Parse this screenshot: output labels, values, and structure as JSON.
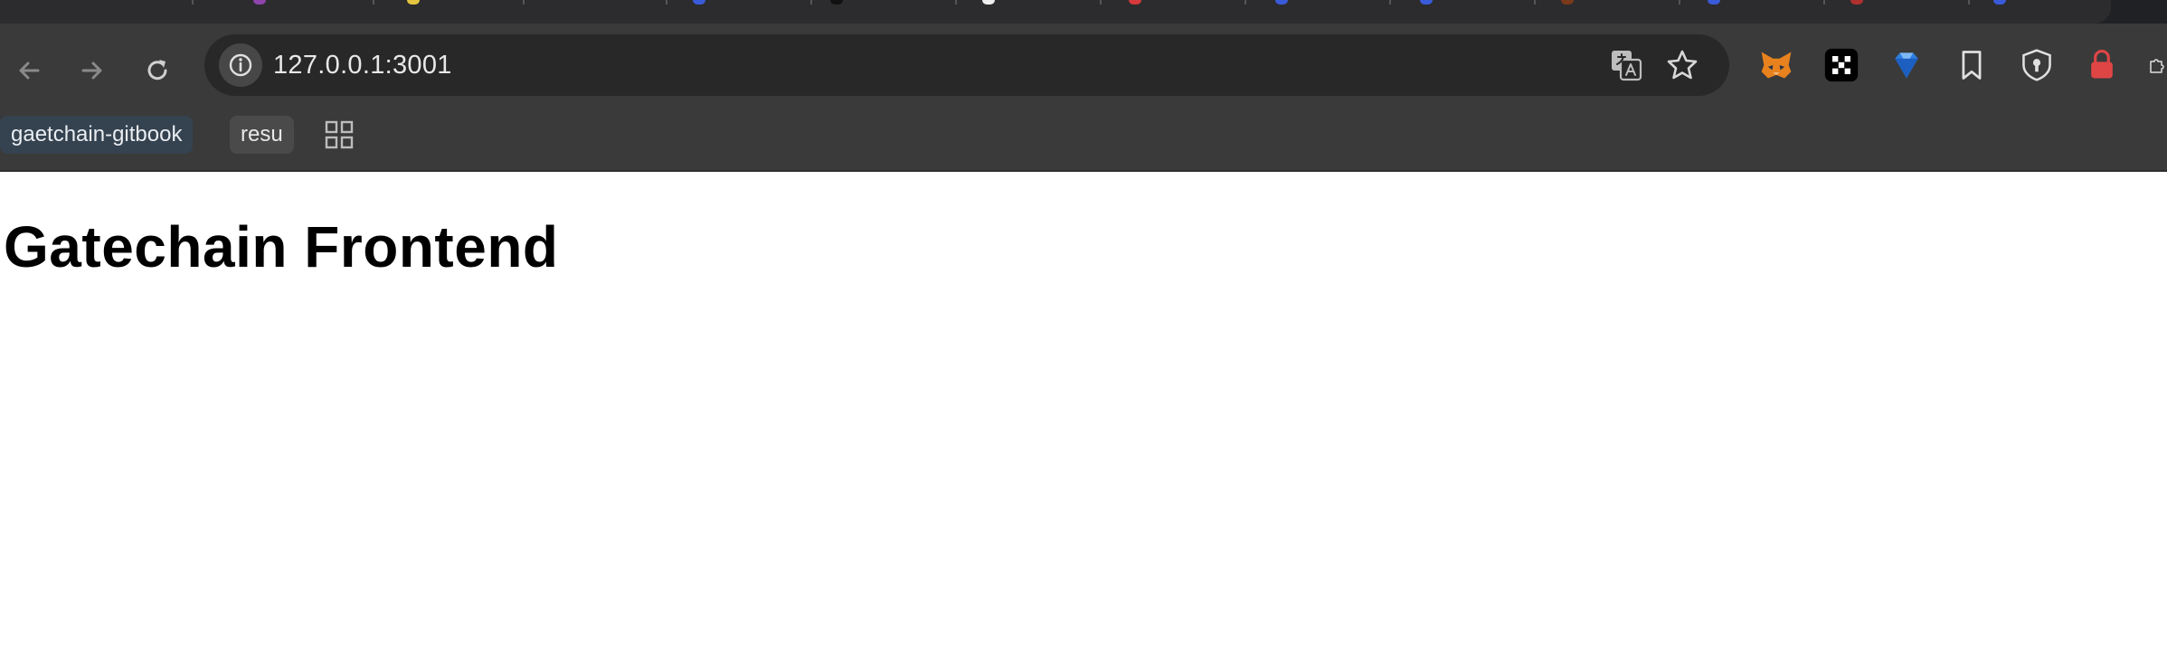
{
  "browser": {
    "omnibox": {
      "url": "127.0.0.1:3001"
    },
    "bookmarks": [
      {
        "label": "gaetchain-gitbook"
      },
      {
        "label": "resu"
      }
    ],
    "extensions": [
      "metamask-icon",
      "qr-icon",
      "gem-icon",
      "bookmark-icon",
      "keyhole-icon",
      "lock-icon",
      "puzzle-icon"
    ]
  },
  "page": {
    "title": "Gatechain Frontend"
  }
}
